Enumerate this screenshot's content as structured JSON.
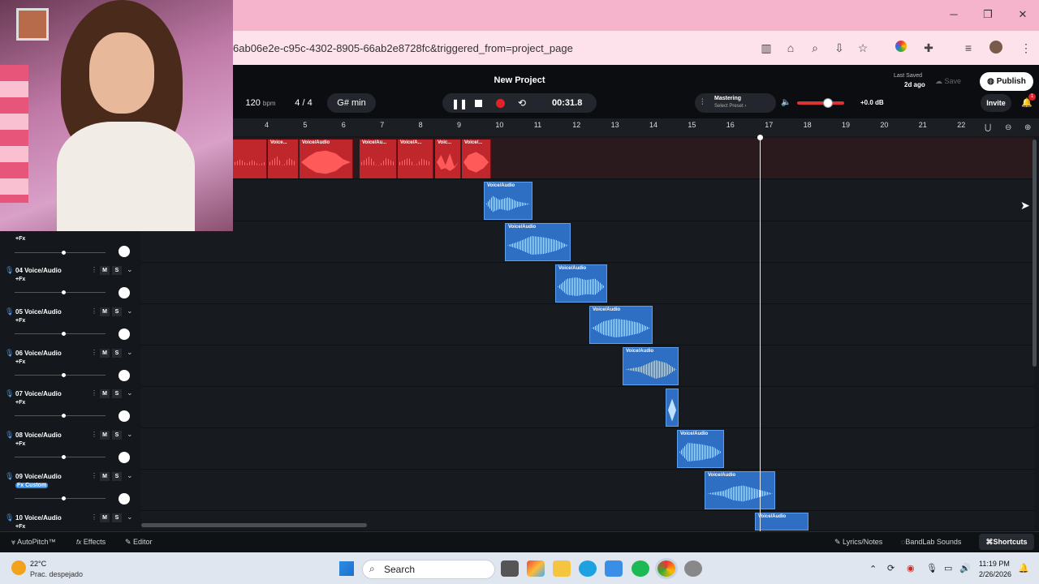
{
  "browser": {
    "url": "6ab06e2e-c95c-4302-8905-66ab2e8728fc&triggered_from=project_page"
  },
  "daw": {
    "title": "New Project",
    "bpm_value": "120",
    "bpm_unit": "bpm",
    "time_sig": "4 / 4",
    "key": "G# min",
    "time": "00:31.8",
    "mastering_label": "Mastering",
    "mastering_preset": "Select Preset ›",
    "volume_db": "+0.0 dB",
    "last_saved": "Last Saved",
    "last_saved_ago": "2d ago",
    "save_label": "Save",
    "publish_label": "Publish",
    "invite_label": "Invite",
    "notification_count": "1",
    "volume_level": 0.5
  },
  "ruler": [
    "4",
    "5",
    "6",
    "7",
    "8",
    "9",
    "10",
    "11",
    "12",
    "13",
    "14",
    "15",
    "16",
    "17",
    "18",
    "19",
    "20",
    "21",
    "22"
  ],
  "clip_label": "Voice/Audio",
  "red_clips": [
    "Voice...",
    "Voice/Audio",
    "Voice/Au...",
    "Voice/A...",
    "Voic...",
    "Voice/..."
  ],
  "tracks": [
    {
      "name": "04 Voice/Audio",
      "fx": "+Fx"
    },
    {
      "name": "05 Voice/Audio",
      "fx": "+Fx"
    },
    {
      "name": "06 Voice/Audio",
      "fx": "+Fx"
    },
    {
      "name": "07 Voice/Audio",
      "fx": "+Fx"
    },
    {
      "name": "08 Voice/Audio",
      "fx": "+Fx"
    },
    {
      "name": "09 Voice/Audio",
      "fx": "Fx Custom"
    },
    {
      "name": "10 Voice/Audio",
      "fx": "+Fx"
    }
  ],
  "top_fx": "+Fx",
  "mute": "M",
  "solo": "S",
  "bottom": {
    "autopitch": "AutoPitch™",
    "effects": "Effects",
    "editor": "Editor",
    "lyrics": "Lyrics/Notes",
    "sounds": "BandLab Sounds",
    "shortcuts": "Shortcuts"
  },
  "taskbar": {
    "temp": "22°C",
    "weather": "Prac. despejado",
    "search": "Search",
    "time": "11:19 PM",
    "date": "2/26/2026"
  }
}
